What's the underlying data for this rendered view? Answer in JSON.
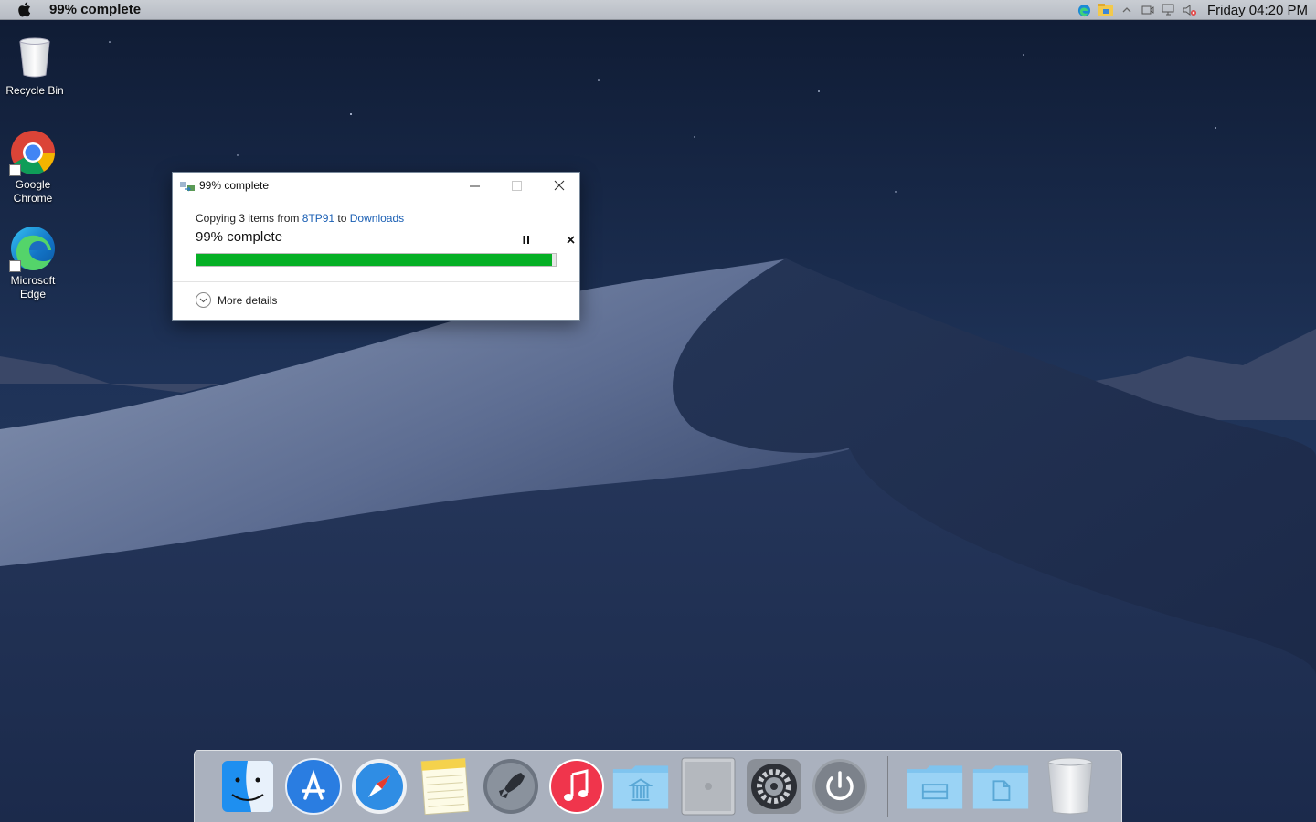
{
  "menubar": {
    "title": "99% complete",
    "clock": "Friday 04:20 PM",
    "tray_icons": [
      "edge-icon",
      "explorer-icon",
      "chevron-up-icon",
      "meet-icon",
      "network-icon",
      "volume-muted-icon"
    ]
  },
  "desktop": {
    "icons": [
      {
        "label": "Recycle Bin",
        "icon": "recycle-bin-icon"
      },
      {
        "label": "Google Chrome",
        "icon": "chrome-icon"
      },
      {
        "label": "Microsoft Edge",
        "icon": "edge-icon"
      }
    ]
  },
  "dialog": {
    "title": "99% complete",
    "copy_prefix": "Copying 3 items from ",
    "source": "8TP91",
    "copy_mid": " to ",
    "destination": "Downloads",
    "status": "99% complete",
    "progress": 0.99,
    "more_details": "More details",
    "progress_color": "#06b025",
    "link_color": "#1a5fb4"
  },
  "dock": {
    "items": [
      "finder-icon",
      "app-store-icon",
      "safari-icon",
      "notes-icon",
      "launchpad-icon",
      "itunes-icon",
      "applications-folder-icon",
      "mac-pro-icon",
      "system-preferences-icon",
      "power-icon",
      "documents-folder-icon",
      "downloads-folder-icon",
      "trash-icon"
    ]
  }
}
